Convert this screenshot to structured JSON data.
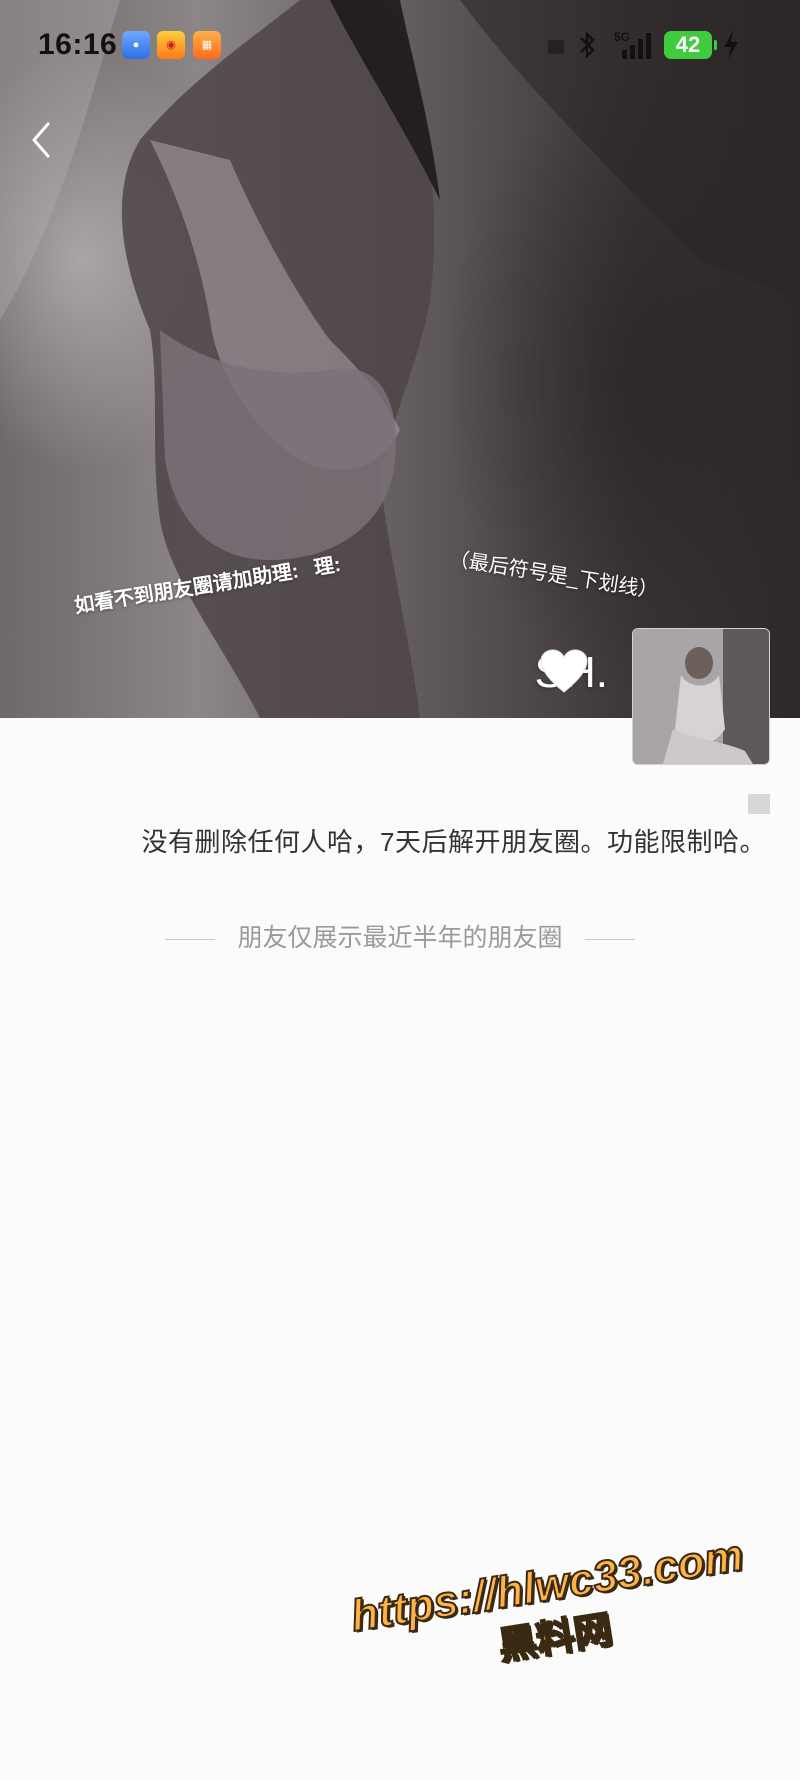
{
  "status_bar": {
    "time": "16:16",
    "battery_level": "42",
    "network_label": "5G",
    "icons": [
      "app-baidu-icon",
      "app-weibo-icon",
      "app-books-icon",
      "bluetooth-icon",
      "signal-icon",
      "charging-icon"
    ]
  },
  "cover": {
    "caption_left": "如看不到朋友圈请加助理:",
    "caption_left_fragment": "理:",
    "caption_right": "（最后符号是_下划线）"
  },
  "profile": {
    "username": "SH.",
    "username_emoji_icon": "white-heart-icon",
    "signature": "没有删除任何人哈，7天后解开朋友圈。功能限制哈。"
  },
  "moments": {
    "visibility_notice": "朋友仅展示最近半年的朋友圈"
  },
  "overlay_watermark": {
    "url": "https://hlwc33.com",
    "name": "黑料网",
    "color": "#ffb347"
  }
}
